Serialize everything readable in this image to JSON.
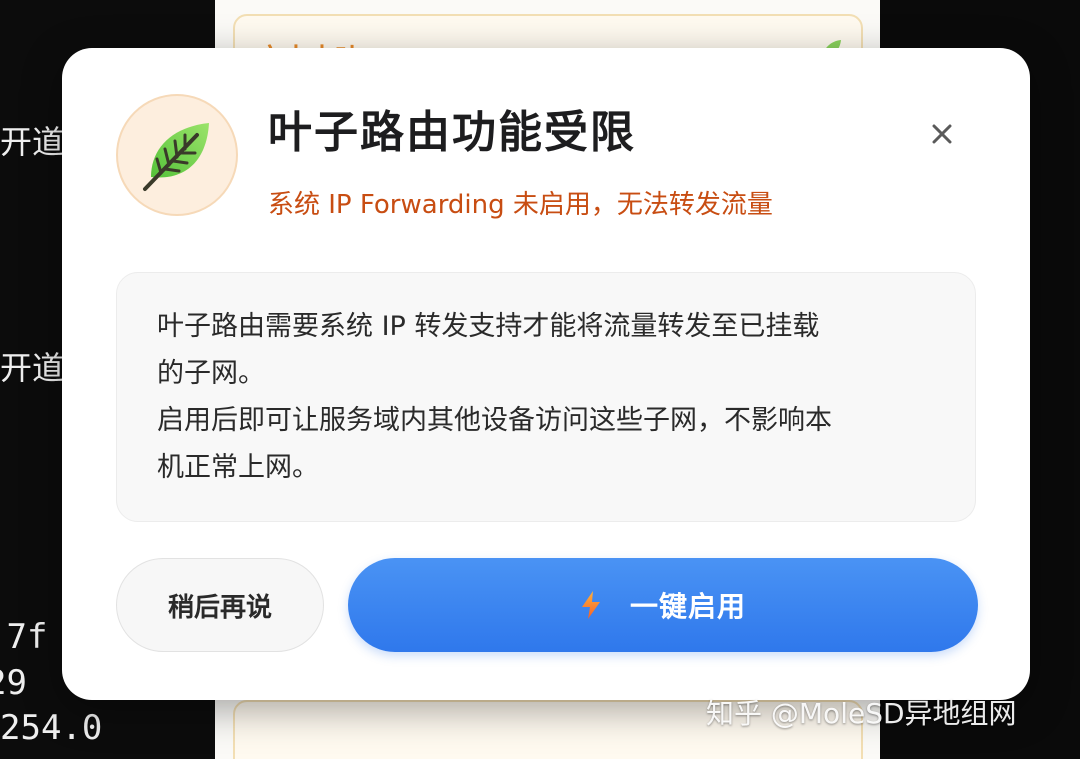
{
  "terminal": {
    "lines": [
      "开道",
      "开道",
      ":7f",
      "29",
      "254.0"
    ]
  },
  "background_panel": {
    "card_title": "启中本叶"
  },
  "dialog": {
    "title": "叶子路由功能受限",
    "subtitle": "系统 IP Forwarding 未启用，无法转发流量",
    "close_icon": "close-icon",
    "badge_icon": "leaf-icon",
    "info_lines": [
      "叶子路由需要系统 IP 转发支持才能将流量转发至已挂载",
      "的子网。",
      "启用后即可让服务域内其他设备访问这些子网，不影响本",
      "机正常上网。"
    ],
    "later_button": "稍后再说",
    "enable_button": "一键启用",
    "enable_icon": "lightning-icon"
  },
  "watermark": "知乎 @MoleSD异地组网",
  "colors": {
    "accent_blue": "#3a84f0",
    "subtitle_orange": "#c84d12",
    "badge_bg": "#fdeede",
    "leaf_green": "#7ed957"
  }
}
